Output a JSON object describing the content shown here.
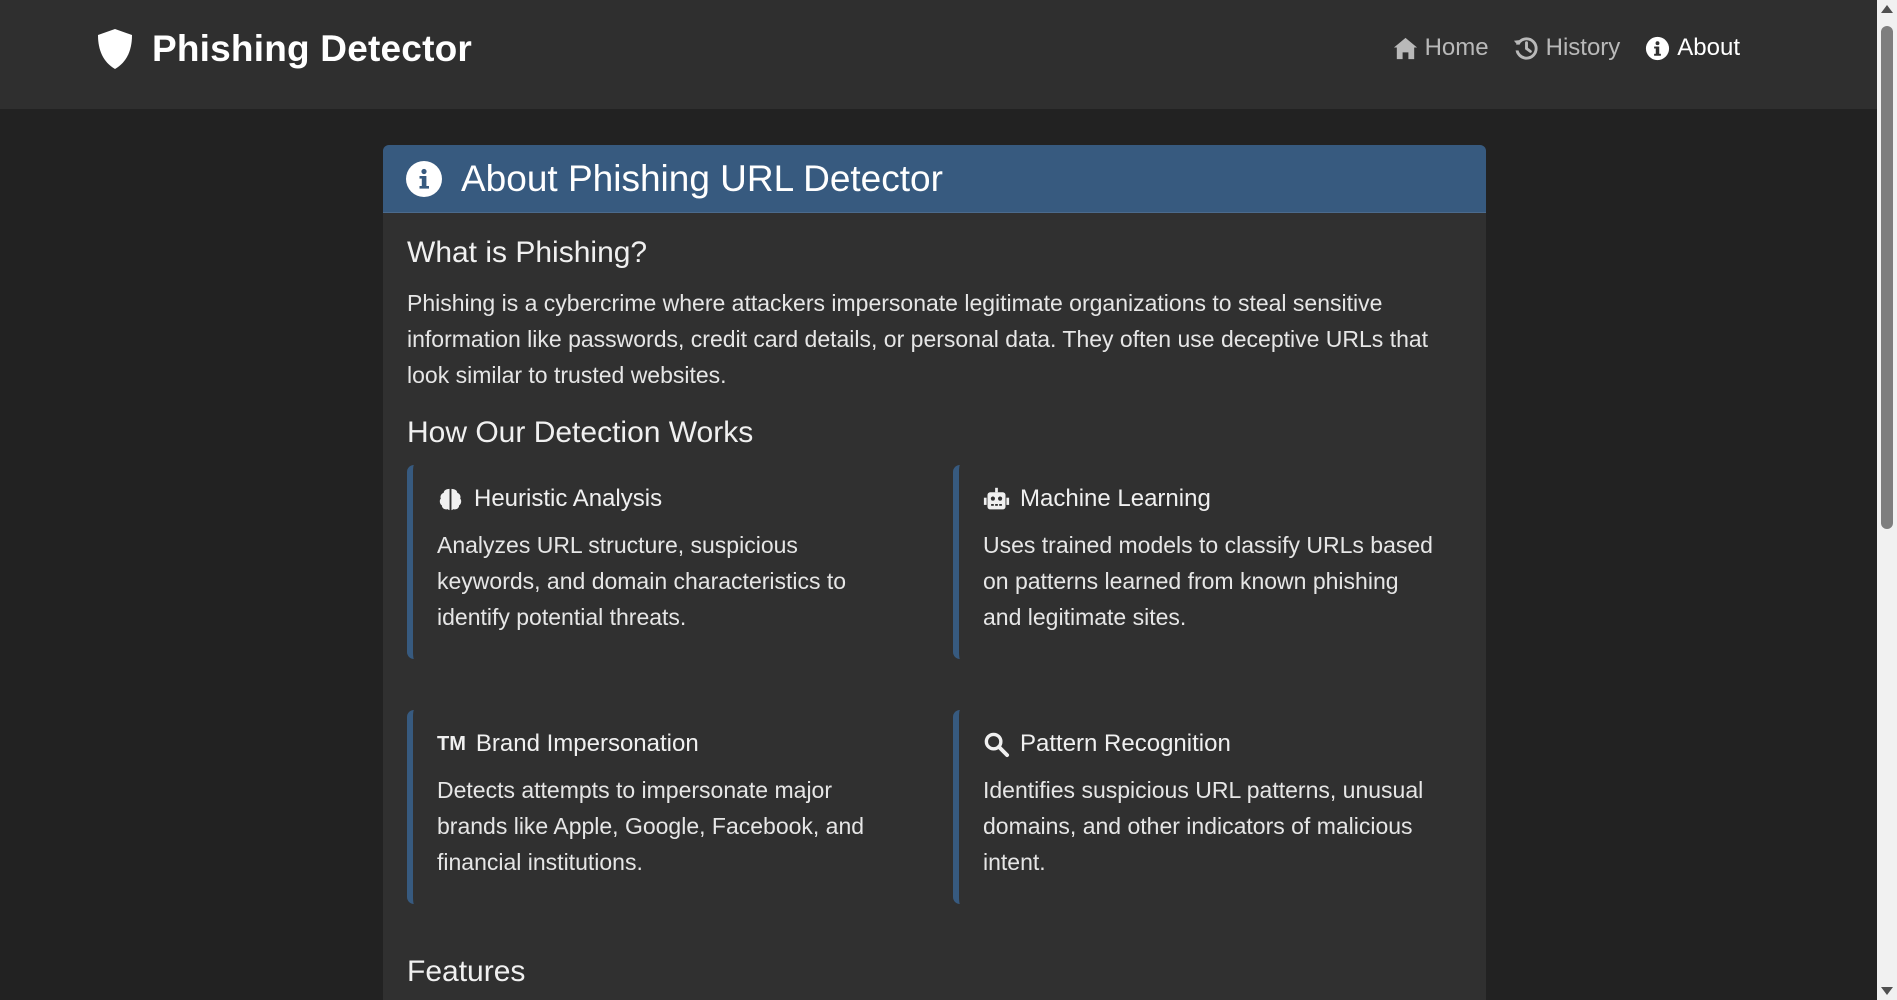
{
  "app": {
    "brand": "Phishing Detector",
    "brand_icon": "shield-icon",
    "accent_color": "#375a7f"
  },
  "nav": {
    "items": [
      {
        "label": "Home",
        "icon": "home-icon",
        "active": false
      },
      {
        "label": "History",
        "icon": "history-icon",
        "active": false
      },
      {
        "label": "About",
        "icon": "info-icon",
        "active": true
      }
    ]
  },
  "card": {
    "title": "About Phishing URL Detector",
    "title_icon": "info-circle-icon",
    "sections": {
      "what_title": "What is Phishing?",
      "what_body": "Phishing is a cybercrime where attackers impersonate legitimate organizations to steal sensitive information like passwords, credit card details, or personal data. They often use deceptive URLs that look similar to trusted websites.",
      "how_title": "How Our Detection Works",
      "features_title": "Features"
    },
    "methods": [
      {
        "title": "Heuristic Analysis",
        "icon": "brain-icon",
        "description": "Analyzes URL structure, suspicious keywords, and domain characteristics to identify potential threats."
      },
      {
        "title": "Machine Learning",
        "icon": "robot-icon",
        "description": "Uses trained models to classify URLs based on patterns learned from known phishing and legitimate sites."
      },
      {
        "title": "Brand Impersonation",
        "icon": "trademark-icon",
        "icon_text": "TM",
        "description": "Detects attempts to impersonate major brands like Apple, Google, Facebook, and financial institutions."
      },
      {
        "title": "Pattern Recognition",
        "icon": "search-icon",
        "description": "Identifies suspicious URL patterns, unusual domains, and other indicators of malicious intent."
      }
    ]
  }
}
